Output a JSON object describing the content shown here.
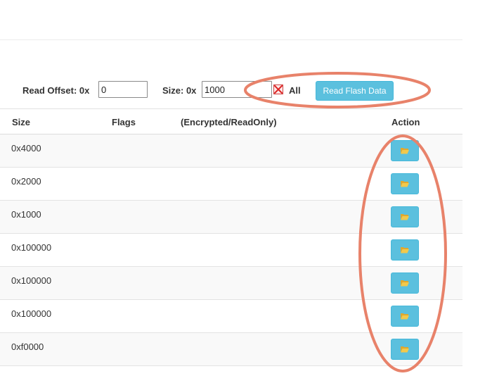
{
  "controls": {
    "read_offset_label": "Read Offset: 0x",
    "read_offset_value": "0",
    "size_label": "Size: 0x",
    "size_value": "1000",
    "all_label": "All",
    "read_button_label": "Read Flash Data"
  },
  "table": {
    "headers": {
      "size": "Size",
      "flags": "Flags",
      "encrypted": "(Encrypted/ReadOnly)",
      "action": "Action"
    },
    "rows": [
      {
        "size": "0x4000"
      },
      {
        "size": "0x2000"
      },
      {
        "size": "0x1000"
      },
      {
        "size": "0x100000"
      },
      {
        "size": "0x100000"
      },
      {
        "size": "0x100000"
      },
      {
        "size": "0xf0000"
      }
    ]
  },
  "icons": {
    "action_icon": "folder-open-icon",
    "checkbox_icon": "checkbox-x-icon"
  },
  "colors": {
    "button_bg": "#5bc0de",
    "folder_icon": "#f2c94c",
    "annotation": "#e8826a"
  }
}
